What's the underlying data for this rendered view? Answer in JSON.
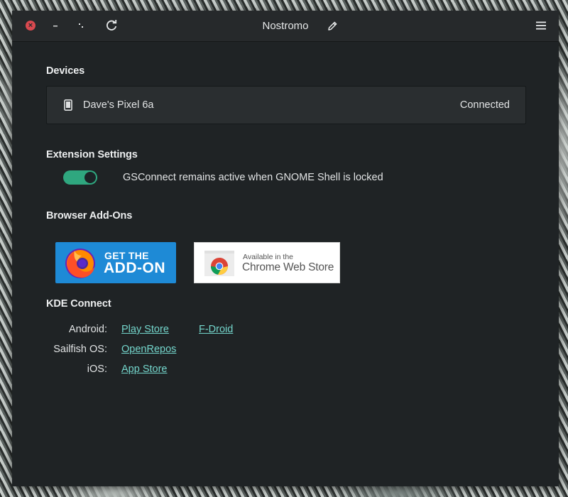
{
  "window": {
    "title": "Nostromo",
    "close_glyph": "×",
    "icons": {
      "close": "close-icon",
      "minimize": "minimize-icon",
      "maximize": "maximize-icon",
      "reload": "reload-icon",
      "edit": "pencil-icon",
      "menu": "hamburger-menu-icon"
    }
  },
  "devices": {
    "heading": "Devices",
    "items": [
      {
        "icon": "smartphone-icon",
        "name": "Dave's Pixel 6a",
        "status": "Connected"
      }
    ]
  },
  "extension_settings": {
    "heading": "Extension Settings",
    "toggle": {
      "label": "GSConnect remains active when GNOME Shell is locked",
      "enabled": true
    }
  },
  "browser_addons": {
    "heading": "Browser Add-Ons",
    "firefox": {
      "line1": "GET THE",
      "line2": "ADD-ON",
      "icon": "firefox-logo"
    },
    "chrome": {
      "line1": "Available in the",
      "line2": "Chrome Web Store",
      "icon": "chrome-web-store-logo"
    }
  },
  "kde_connect": {
    "heading": "KDE Connect",
    "rows": [
      {
        "label": "Android:",
        "links": [
          "Play Store",
          "F-Droid"
        ]
      },
      {
        "label": "Sailfish OS:",
        "links": [
          "OpenRepos"
        ]
      },
      {
        "label": "iOS:",
        "links": [
          "App Store"
        ]
      }
    ]
  },
  "colors": {
    "window_bg": "#1f2325",
    "titlebar_bg": "#26292b",
    "accent_toggle": "#2fa77f",
    "link": "#74d6cc",
    "close_red": "#d9494f",
    "firefox_blue": "#1e8ad6"
  }
}
